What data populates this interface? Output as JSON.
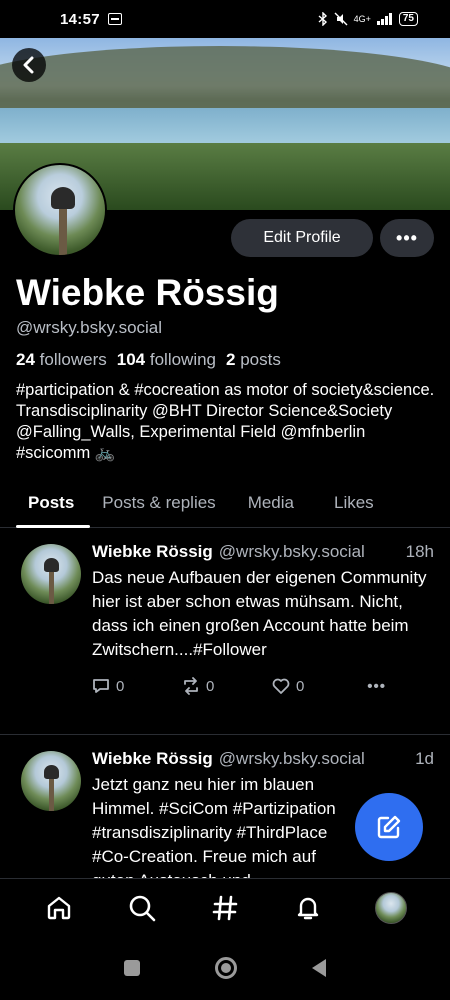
{
  "status_bar": {
    "time": "14:57",
    "network": "4G+",
    "battery": "75"
  },
  "header": {
    "back_icon": "chevron-left-icon"
  },
  "profile": {
    "display_name": "Wiebke Rössig",
    "handle": "@wrsky.bsky.social",
    "followers_count": "24",
    "followers_label": "followers",
    "following_count": "104",
    "following_label": "following",
    "posts_count": "2",
    "posts_label": "posts",
    "bio": "#participation & #cocreation as motor of society&science. Transdisciplinarity @BHT Director Science&Society @Falling_Walls, Experimental Field @mfnberlin #scicomm 🚲",
    "edit_label": "Edit Profile",
    "more_label": "•••"
  },
  "tabs": [
    {
      "label": "Posts",
      "active": true
    },
    {
      "label": "Posts & replies",
      "active": false
    },
    {
      "label": "Media",
      "active": false
    },
    {
      "label": "Likes",
      "active": false
    }
  ],
  "posts": [
    {
      "author": "Wiebke Rössig",
      "handle": "@wrsky.bsky.social",
      "time": "18h",
      "text": "Das neue Aufbauen der eigenen Community hier ist aber schon etwas mühsam. Nicht, dass ich einen großen Account hatte beim Zwitschern....#Follower",
      "replies": "0",
      "reposts": "0",
      "likes": "0"
    },
    {
      "author": "Wiebke Rössig",
      "handle": "@wrsky.bsky.social",
      "time": "1d",
      "text": "Jetzt ganz neu hier im blauen Himmel. #SciCom #Partizipation #transdisziplinarity #ThirdPlace #Co-Creation. Freue mich auf guten Austausch und",
      "replies": "",
      "reposts": "",
      "likes": ""
    }
  ],
  "colors": {
    "background": "#000000",
    "button_bg": "#2e3138",
    "fab": "#2f6ef0",
    "muted_text": "#aeb3bb"
  },
  "bottom_nav": [
    "home-icon",
    "search-icon",
    "hashtag-icon",
    "bell-icon",
    "profile-avatar"
  ]
}
